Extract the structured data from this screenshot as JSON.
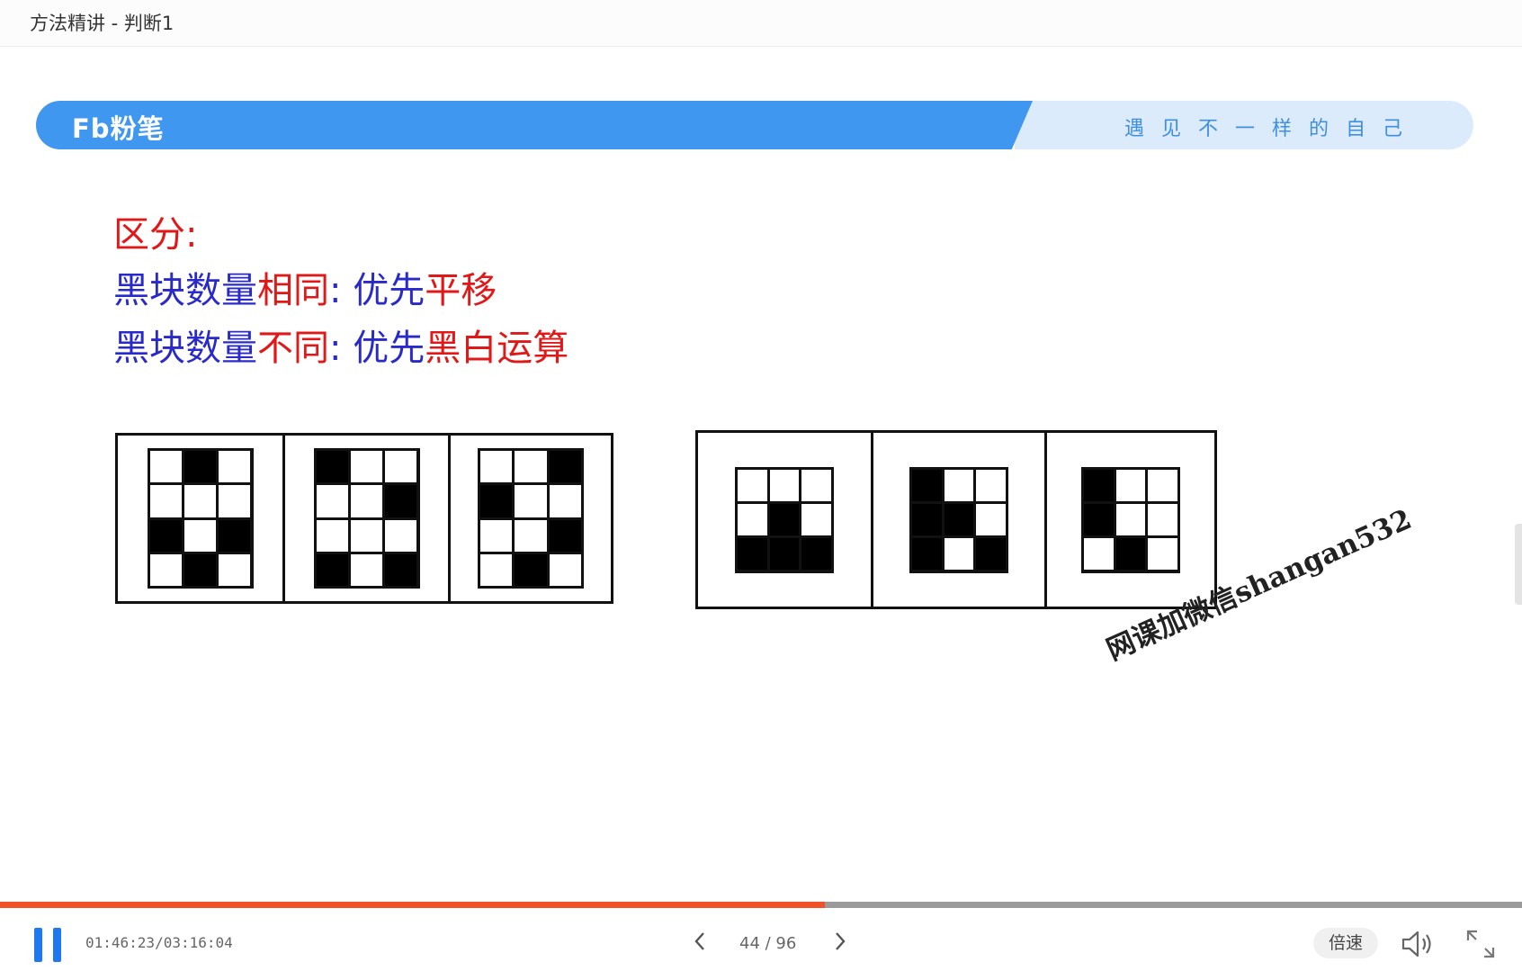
{
  "window": {
    "title": "方法精讲 - 判断1"
  },
  "banner": {
    "logo": "Fb粉笔",
    "slogan": "遇见不一样的自己"
  },
  "content": {
    "heading": "区分:",
    "line1": {
      "part1": "黑块数量",
      "part2": "相同",
      "part3": ":  优先",
      "part4": "平移"
    },
    "line2": {
      "part1": "黑块数量",
      "part2": "不同",
      "part3": ":  优先",
      "part4": "黑白运算"
    }
  },
  "figures": {
    "left": [
      [
        [
          0,
          1,
          0
        ],
        [
          0,
          0,
          0
        ],
        [
          1,
          0,
          1
        ],
        [
          0,
          1,
          0
        ]
      ],
      [
        [
          1,
          0,
          0
        ],
        [
          0,
          0,
          1
        ],
        [
          0,
          0,
          0
        ],
        [
          1,
          0,
          1
        ]
      ],
      [
        [
          0,
          0,
          1
        ],
        [
          1,
          0,
          0
        ],
        [
          0,
          0,
          1
        ],
        [
          0,
          1,
          0
        ]
      ]
    ],
    "right": [
      [
        [
          0,
          0,
          0
        ],
        [
          0,
          1,
          0
        ],
        [
          1,
          1,
          1
        ]
      ],
      [
        [
          1,
          0,
          0
        ],
        [
          1,
          1,
          0
        ],
        [
          1,
          0,
          1
        ]
      ],
      [
        [
          1,
          0,
          0
        ],
        [
          1,
          0,
          0
        ],
        [
          0,
          1,
          0
        ]
      ]
    ]
  },
  "watermark": "网课加微信shangan532",
  "player": {
    "time": "01:46:23/03:16:04",
    "page": "44 / 96",
    "speed_label": "倍速",
    "progress_fraction": 0.542,
    "accent": "#1e78f0",
    "progress_color": "#f0502a",
    "icons": [
      "pause-icon",
      "chevron-left-icon",
      "chevron-right-icon",
      "volume-icon",
      "fullscreen-icon"
    ]
  }
}
